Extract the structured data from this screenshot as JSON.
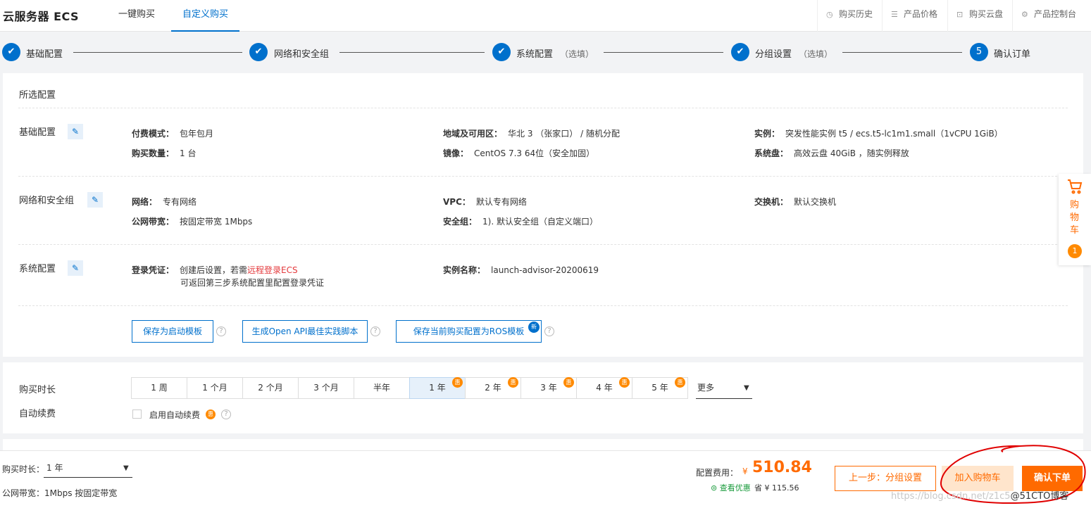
{
  "header": {
    "brand": "云服务器 ECS",
    "tabs": [
      {
        "label": "一键购买"
      },
      {
        "label": "自定义购买"
      }
    ],
    "links": [
      {
        "label": "购买历史",
        "icon": "clock-icon"
      },
      {
        "label": "产品价格",
        "icon": "list-icon"
      },
      {
        "label": "购买云盘",
        "icon": "lock-icon"
      },
      {
        "label": "产品控制台",
        "icon": "gear-icon"
      }
    ]
  },
  "steps": [
    {
      "label": "基础配置",
      "optional": "",
      "mark": "✔"
    },
    {
      "label": "网络和安全组",
      "optional": "",
      "mark": "✔"
    },
    {
      "label": "系统配置",
      "optional": "（选填）",
      "mark": "✔"
    },
    {
      "label": "分组设置",
      "optional": "（选填）",
      "mark": "✔"
    },
    {
      "label": "确认订单",
      "optional": "",
      "mark": "5"
    }
  ],
  "summary": {
    "title": "所选配置",
    "basic": {
      "label": "基础配置",
      "billing_k": "付费模式：",
      "billing_v": "包年包月",
      "qty_k": "购买数量：",
      "qty_v": "1 台",
      "region_k": "地域及可用区：",
      "region_v": "华北 3 （张家口） / 随机分配",
      "image_k": "镜像：",
      "image_v": "CentOS 7.3 64位（安全加固）",
      "instance_k": "实例：",
      "instance_v": "突发性能实例 t5 / ecs.t5-lc1m1.small（1vCPU 1GiB）",
      "disk_k": "系统盘：",
      "disk_v": "高效云盘 40GiB ，随实例释放"
    },
    "network": {
      "label": "网络和安全组",
      "net_k": "网络：",
      "net_v": "专有网络",
      "bw_k": "公网带宽：",
      "bw_v": "按固定带宽 1Mbps",
      "vpc_k": "VPC：",
      "vpc_v": "默认专有网络",
      "sg_k": "安全组：",
      "sg_v": "1). 默认安全组（自定义端口）",
      "switch_k": "交换机：",
      "switch_v": "默认交换机"
    },
    "system": {
      "label": "系统配置",
      "login_k": "登录凭证：",
      "login_v1": "创建后设置，若需",
      "login_link": "远程登录ECS",
      "login_v2": "可返回第三步系统配置里配置登录凭证",
      "name_k": "实例名称：",
      "name_v": "launch-advisor-20200619"
    },
    "actions": {
      "save_template": "保存为启动模板",
      "openapi": "生成Open API最佳实践脚本",
      "ros": "保存当前购买配置为ROS模板",
      "new_badge": "新",
      "help": "?"
    }
  },
  "duration": {
    "label": "购买时长",
    "options": [
      {
        "label": "1 周"
      },
      {
        "label": "1 个月"
      },
      {
        "label": "2 个月"
      },
      {
        "label": "3 个月"
      },
      {
        "label": "半年"
      },
      {
        "label": "1 年"
      },
      {
        "label": "2 年"
      },
      {
        "label": "3 年"
      },
      {
        "label": "4 年"
      },
      {
        "label": "5 年"
      }
    ],
    "discount_badge": "惠",
    "selected": "1 年",
    "more": "更多",
    "auto_renew_label": "自动续费",
    "auto_renew_checkbox": "启用自动续费"
  },
  "cart": {
    "text": "购物车",
    "count": "1"
  },
  "footer": {
    "duration_label": "购买时长：",
    "duration_value": "1 年",
    "bandwidth_label": "公网带宽：",
    "bandwidth_value": "1Mbps 按固定带宽",
    "price_label": "配置费用：",
    "currency": "¥",
    "price": "510.84",
    "discount_link": "查看优惠",
    "save_label": "省",
    "save_amount": "¥ 115.56",
    "prev_button": "上一步：分组设置",
    "cart_button": "加入购物车",
    "confirm_button": "确认下单"
  },
  "watermark": {
    "url": "https://blog.csdn.net/z1c5",
    "site": "@51CTO博客"
  },
  "colors": {
    "primary": "#0070cc",
    "accent": "#ff6a00",
    "annotation": "#e00000"
  }
}
